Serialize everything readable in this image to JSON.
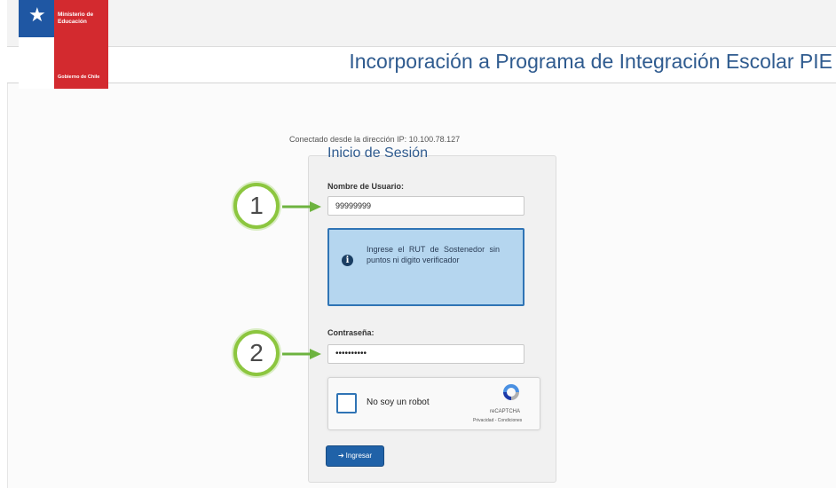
{
  "header": {
    "ministry": "Ministerio de Educación",
    "government": "Gobierno de Chile",
    "title": "Incorporación a Programa de Integración Escolar PIE"
  },
  "connection": {
    "text": "Conectado desde la dirección IP: 10.100.78.127"
  },
  "login": {
    "title": "Inicio de Sesión",
    "username_label": "Nombre de Usuario:",
    "username_value": "99999999",
    "info_text": "Ingrese el RUT de Sostenedor sin puntos ni digito verificador",
    "password_label": "Contraseña:",
    "password_value": "••••••••••",
    "captcha_label": "No soy un robot",
    "captcha_brand": "reCAPTCHA",
    "captcha_links": "Privacidad - Condiciones",
    "submit_label": "Ingresar"
  },
  "callouts": [
    "1",
    "2"
  ],
  "colors": {
    "title_blue": "#2f5b8f",
    "logo_blue": "#1f57a3",
    "logo_red": "#d32a2f",
    "info_bg": "#b5d6ef",
    "callout_green": "#8cc63f",
    "button_blue": "#2062a8"
  }
}
